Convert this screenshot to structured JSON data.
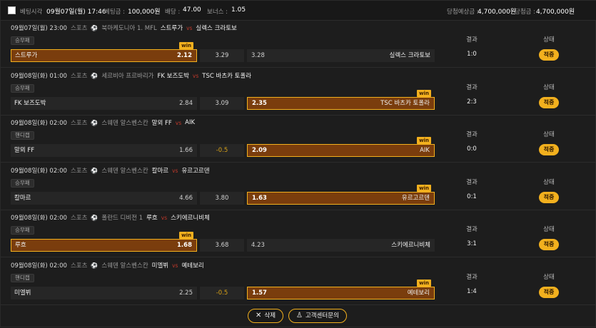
{
  "header": {
    "bet_time_label": "베팅시각",
    "bet_time_value": "09월07일(월) 17:46",
    "bet_amount_label": "베팅금 :",
    "bet_amount_value": "100,000원",
    "odds_label": "배당 :",
    "odds_value": "47.00",
    "bonus_label": "보너스 :",
    "bonus_value": "1.05",
    "expected_win_label": "당첨예상금 :",
    "expected_win_value": "4,700,000원",
    "win_amount_label": "당첨금 :",
    "win_amount_value": "4,700,000원"
  },
  "labels": {
    "sport": "스포츠",
    "vs": "vs",
    "result": "결과",
    "status": "상태",
    "win": "win"
  },
  "bets": [
    {
      "datetime": "09월07일(월) 23:00",
      "league": "북마케도니아 1. MFL",
      "home": "스트루가",
      "away": "실렉스 크라토보",
      "market": "승무패",
      "home_odds": "2.12",
      "middle": "3.29",
      "away_odds": "3.28",
      "winner": "home",
      "score": "1:0",
      "status": "적중"
    },
    {
      "datetime": "09월08일(화) 01:00",
      "league": "세르비아 프르바리가",
      "home": "FK 보즈도박",
      "away": "TSC 바츠카 토폴라",
      "market": "승무패",
      "home_odds": "2.84",
      "middle": "3.09",
      "away_odds": "2.35",
      "winner": "away",
      "score": "2:3",
      "status": "적중"
    },
    {
      "datetime": "09월08일(화) 02:00",
      "league": "스웨덴 알스벤스칸",
      "home": "말뫼 FF",
      "away": "AIK",
      "market": "핸디캡",
      "home_odds": "1.66",
      "middle": "-0.5",
      "away_odds": "2.09",
      "winner": "away",
      "score": "0:0",
      "status": "적중"
    },
    {
      "datetime": "09월08일(화) 02:00",
      "league": "스웨덴 알스벤스칸",
      "home": "칼마르",
      "away": "유르고르덴",
      "market": "승무패",
      "home_odds": "4.66",
      "middle": "3.80",
      "away_odds": "1.63",
      "winner": "away",
      "score": "0:1",
      "status": "적중"
    },
    {
      "datetime": "09월08일(화) 02:00",
      "league": "폴란드 디비전 1",
      "home": "루흐",
      "away": "스키에르니비체",
      "market": "승무패",
      "home_odds": "1.68",
      "middle": "3.68",
      "away_odds": "4.23",
      "winner": "home",
      "score": "3:1",
      "status": "적중"
    },
    {
      "datetime": "09월08일(화) 02:00",
      "league": "스웨덴 알스벤스칸",
      "home": "미엘뷔",
      "away": "예테보리",
      "market": "핸디캡",
      "home_odds": "2.25",
      "middle": "-0.5",
      "away_odds": "1.57",
      "winner": "away",
      "score": "1:4",
      "status": "적중"
    }
  ],
  "footer": {
    "delete_label": "삭제",
    "support_label": "고객센터문의"
  },
  "colors": {
    "accent": "#f2b01e",
    "win_fill": "#7a3d0d",
    "vs": "#c0392b",
    "background": "#1d1d1d"
  }
}
